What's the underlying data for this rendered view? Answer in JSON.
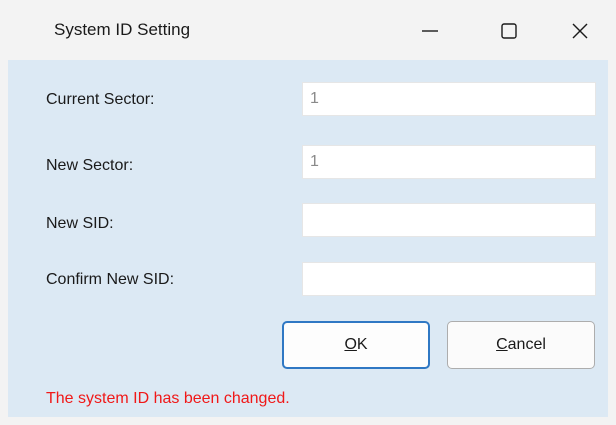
{
  "window": {
    "title": "System ID Setting"
  },
  "titlebar_buttons": {
    "minimize_icon": "minimize-icon",
    "maximize_icon": "maximize-icon",
    "close_icon": "close-icon"
  },
  "form": {
    "current_sector": {
      "label": "Current Sector:",
      "value": "1"
    },
    "new_sector": {
      "label": "New Sector:",
      "value": "1"
    },
    "new_sid": {
      "label": "New SID:",
      "value": ""
    },
    "confirm_new_sid": {
      "label": "Confirm New SID:",
      "value": ""
    }
  },
  "buttons": {
    "ok": {
      "mnemonic": "O",
      "rest": "K"
    },
    "cancel": {
      "mnemonic": "C",
      "rest": "ancel"
    }
  },
  "status": {
    "message": "The system ID has been changed.",
    "color": "#f01818"
  },
  "colors": {
    "client_background": "#dce9f4",
    "titlebar_background": "#f3f3f3",
    "default_button_border": "#2f78c4"
  }
}
